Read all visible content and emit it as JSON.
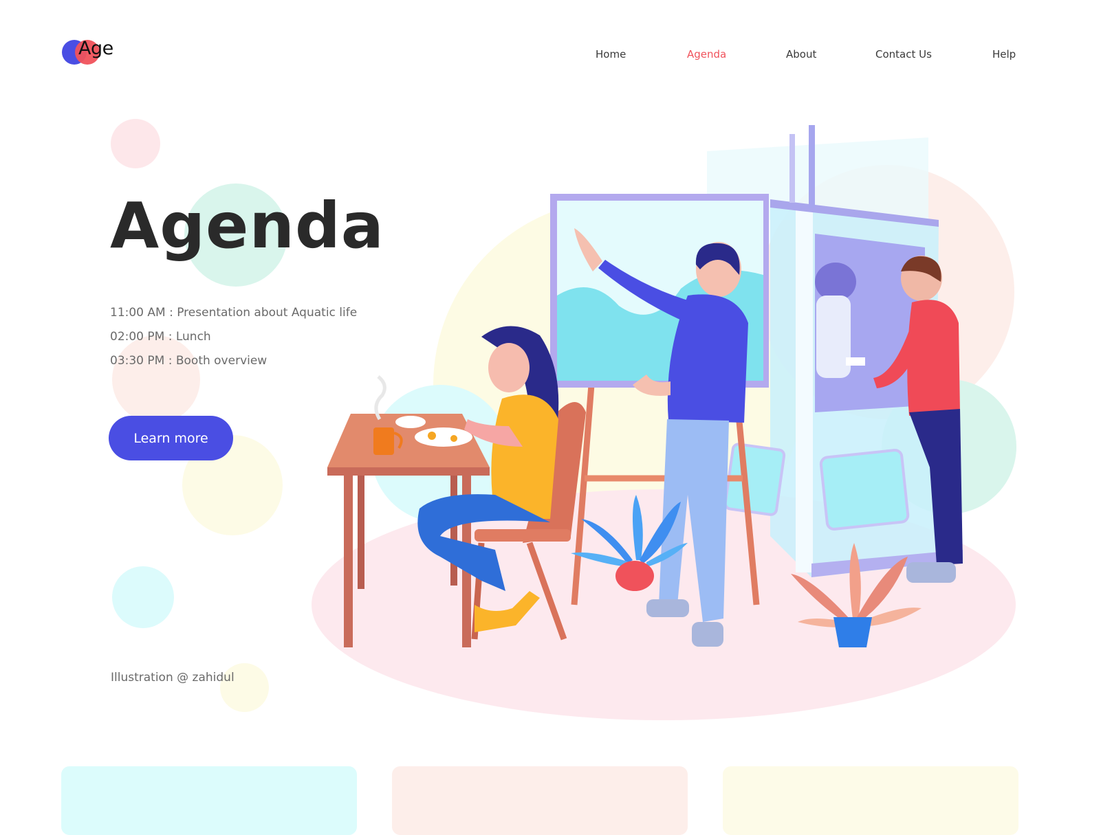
{
  "brand": {
    "logo_text": "Age",
    "colors": {
      "primary": "#4a4ee3",
      "accent": "#f0525b"
    }
  },
  "nav": {
    "items": [
      {
        "label": "Home",
        "active": false
      },
      {
        "label": "Agenda",
        "active": true
      },
      {
        "label": "About",
        "active": false
      },
      {
        "label": "Contact Us",
        "active": false
      },
      {
        "label": "Help",
        "active": false
      }
    ]
  },
  "hero": {
    "title": "Agenda",
    "agenda": [
      "11:00 AM : Presentation about Aquatic life",
      "02:00 PM : Lunch",
      "03:30 PM : Booth overview"
    ],
    "cta_label": "Learn more",
    "credit": "Illustration @ zahidul"
  },
  "cards": [
    {
      "color": "#dcfcfc"
    },
    {
      "color": "#fdeeea"
    },
    {
      "color": "#fdfbe8"
    }
  ]
}
